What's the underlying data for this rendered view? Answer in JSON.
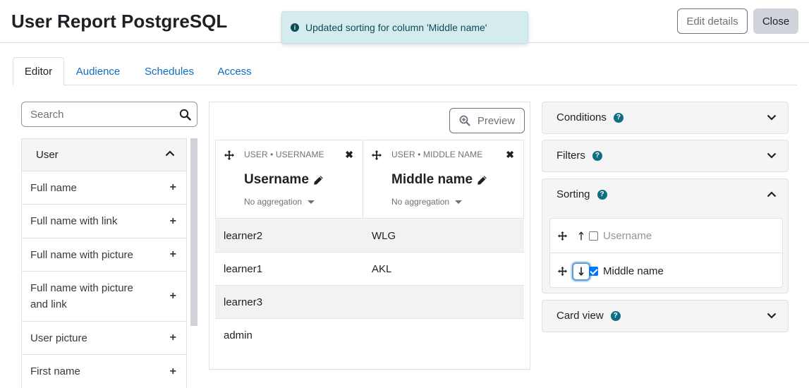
{
  "header": {
    "title": "User Report PostgreSQL",
    "edit_label": "Edit details",
    "close_label": "Close"
  },
  "toast": {
    "message": "Updated sorting for column 'Middle name'",
    "icon": "info-icon"
  },
  "tabs": [
    {
      "label": "Editor",
      "active": true
    },
    {
      "label": "Audience",
      "active": false
    },
    {
      "label": "Schedules",
      "active": false
    },
    {
      "label": "Access",
      "active": false
    }
  ],
  "search": {
    "placeholder": "Search",
    "value": ""
  },
  "sidebar": {
    "section": "User",
    "items": [
      {
        "label": "Full name"
      },
      {
        "label": "Full name with link"
      },
      {
        "label": "Full name with picture"
      },
      {
        "label": "Full name with picture and link"
      },
      {
        "label": "User picture"
      },
      {
        "label": "First name"
      }
    ]
  },
  "editor": {
    "preview_label": "Preview",
    "columns": [
      {
        "source": "USER • USERNAME",
        "name": "Username",
        "aggregation": "No aggregation"
      },
      {
        "source": "USER • MIDDLE NAME",
        "name": "Middle name",
        "aggregation": "No aggregation"
      }
    ],
    "rows": [
      [
        "learner2",
        "WLG"
      ],
      [
        "learner1",
        "AKL"
      ],
      [
        "learner3",
        ""
      ],
      [
        "admin",
        ""
      ]
    ]
  },
  "panels": {
    "conditions": "Conditions",
    "filters": "Filters",
    "sorting": "Sorting",
    "card_view": "Card view",
    "help_glyph": "?",
    "sorting_items": [
      {
        "label": "Username",
        "direction": "ascending",
        "checked": false
      },
      {
        "label": "Middle name",
        "direction": "descending",
        "checked": true
      }
    ]
  },
  "colors": {
    "link": "#0f6cbf",
    "toast_bg": "#d5ecef",
    "help_icon": "#0f6e82",
    "checkbox": "#0075ff"
  }
}
